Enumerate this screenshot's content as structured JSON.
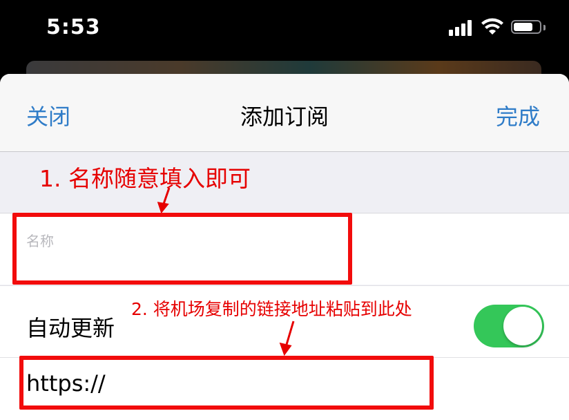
{
  "status_bar": {
    "time": "5:53",
    "battery_level": 0.75
  },
  "nav": {
    "close_label": "关闭",
    "title": "添加订阅",
    "done_label": "完成"
  },
  "form": {
    "name_placeholder": "名称",
    "name_value": "",
    "auto_update_label": "自动更新",
    "auto_update_on": true,
    "url_value": "https://"
  },
  "annotations": {
    "note_1": "1. 名称随意填入即可",
    "note_2": "2. 将机场复制的链接地址粘贴到此处",
    "highlight_color": "#f20c0c"
  },
  "colors": {
    "accent": "#2f7cc8",
    "toggle_on": "#34c759"
  }
}
